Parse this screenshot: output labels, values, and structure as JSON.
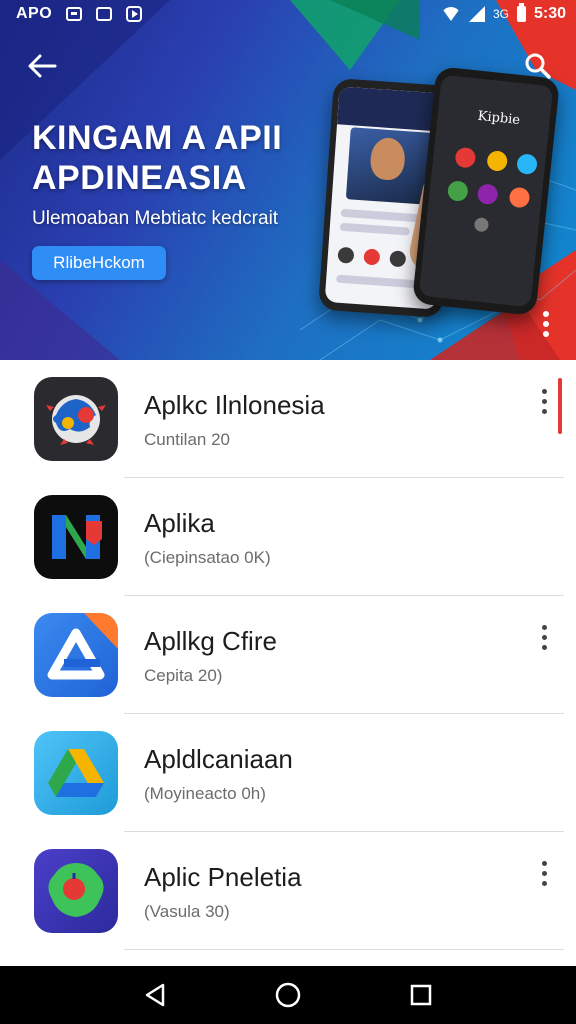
{
  "status_bar": {
    "left_text": "APO",
    "clock": "5:30",
    "network_label": "3G",
    "icons": [
      "message-icon",
      "download-icon",
      "play-store-icon",
      "wifi-icon",
      "signal-icon",
      "battery-icon"
    ]
  },
  "hero": {
    "title_line1": "KINGAM A APII",
    "title_line2": "APDINEASIA",
    "subtitle": "Ulemoaban Mebtiatc kedcrait",
    "cta_label": "RlibeHckom",
    "phone_b_label": "Kipbie",
    "colors": {
      "gradient_start": "#1c2a8a",
      "gradient_end": "#0f8bd0",
      "accent_red": "#e5332a",
      "cta": "#2f8ef5"
    }
  },
  "apps": [
    {
      "title": "Aplkc Ilnlonesia",
      "subtitle": "Cuntilan 20",
      "icon": "puzzle-globe-icon",
      "has_menu": true
    },
    {
      "title": "Aplika",
      "subtitle": "(Ciepinsatao 0K)",
      "icon": "navigation-n-icon",
      "has_menu": false
    },
    {
      "title": "Apllkg Cfire",
      "subtitle": "Cepita 20)",
      "icon": "blue-triangle-icon",
      "has_menu": true
    },
    {
      "title": "Apldlcaniaan",
      "subtitle": "(Moyineacto 0h)",
      "icon": "drive-triangle-icon",
      "has_menu": false
    },
    {
      "title": "Aplic Pneletia",
      "subtitle": "(Vasula 30)",
      "icon": "green-blob-icon",
      "has_menu": true
    }
  ],
  "nav_bar": {
    "buttons": [
      "back-triangle-icon",
      "home-circle-icon",
      "recents-square-icon"
    ]
  }
}
